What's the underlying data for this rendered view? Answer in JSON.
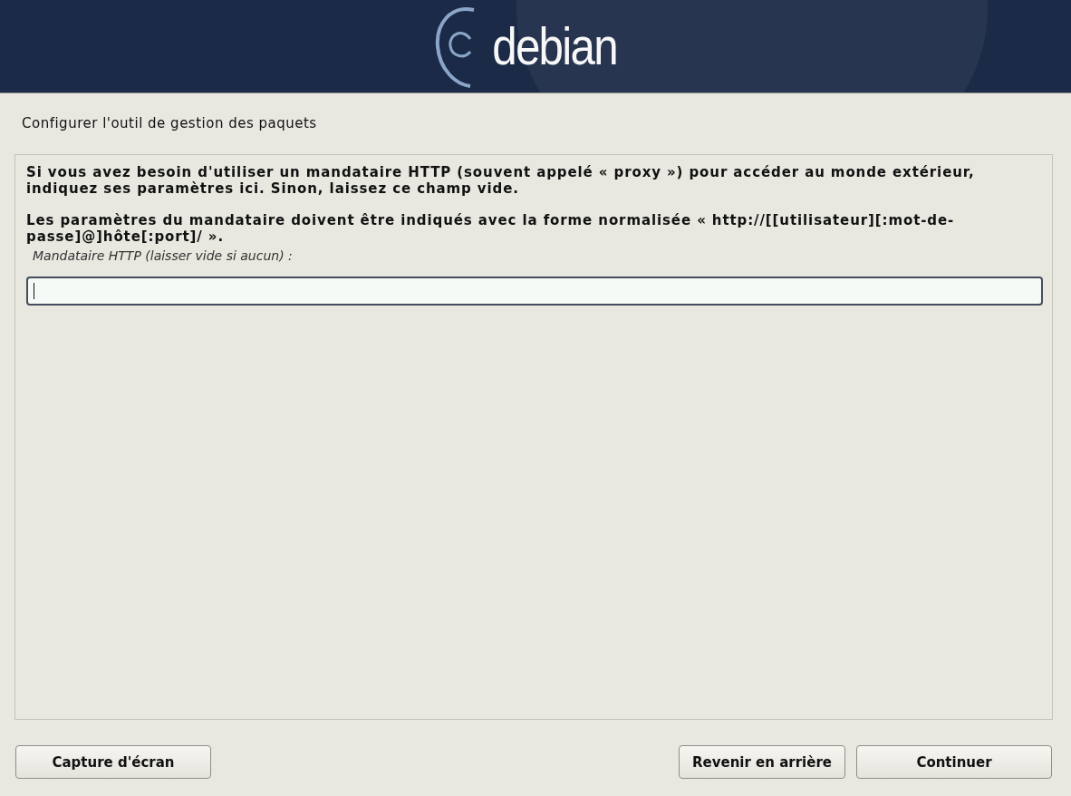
{
  "header": {
    "logo_text": "debian"
  },
  "title": "Configurer l'outil de gestion des paquets",
  "paragraphs": [
    "Si vous avez besoin d'utiliser un mandataire HTTP (souvent appelé « proxy ») pour accéder au monde extérieur, indiquez ses paramètres ici. Sinon, laissez ce champ vide.",
    "Les paramètres du mandataire doivent être indiqués avec la forme normalisée « http://[[utilisateur][:mot-de-passe]@]hôte[:port]/ »."
  ],
  "field": {
    "label": "Mandataire HTTP (laisser vide si aucun) :",
    "focused": true
  },
  "footer": {
    "left_buttons": [
      "Capture d'écran"
    ],
    "right_buttons": [
      "Revenir en arrière",
      "Continuer"
    ]
  }
}
